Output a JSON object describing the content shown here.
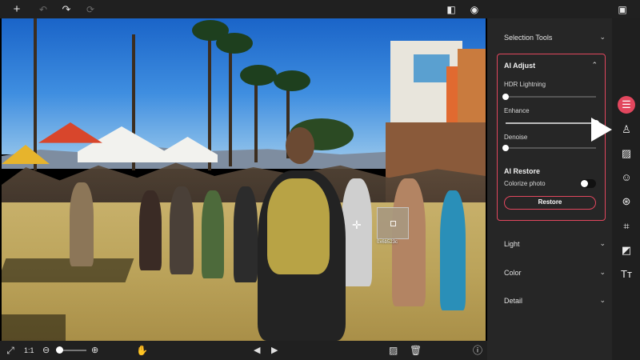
{
  "toolbar": {
    "icons": [
      "add-icon",
      "undo-icon",
      "redo-icon",
      "reset-icon",
      "compare-icon",
      "preview-eye-icon",
      "save-icon"
    ]
  },
  "canvas": {
    "color_readout": "0x6b523c"
  },
  "bottombar": {
    "zoom_ratio": "1:1",
    "zoom_level": 0.05
  },
  "panel": {
    "selection_tools": "Selection Tools",
    "ai_adjust": {
      "title": "AI Adjust",
      "sliders": [
        {
          "label": "HDR Lightning",
          "value": 0
        },
        {
          "label": "Enhance",
          "value": 1
        },
        {
          "label": "Denoise",
          "value": 0
        }
      ],
      "restore_title": "AI Restore",
      "colorize_label": "Colorize photo",
      "colorize_on": false,
      "restore_button": "Restore"
    },
    "light": "Light",
    "color": "Color",
    "detail": "Detail"
  },
  "rail": {
    "items": [
      "adjust-sliders-icon",
      "stamp-icon",
      "image-icon",
      "face-icon",
      "color-circles-icon",
      "crop-icon",
      "transform-icon",
      "text-icon"
    ],
    "active": "adjust-sliders-icon"
  },
  "colors": {
    "accent": "#e2475e",
    "panel_bg": "#262626",
    "toolbar_bg": "#202020"
  }
}
